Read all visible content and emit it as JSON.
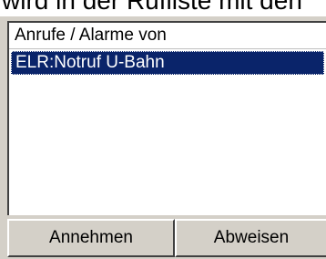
{
  "caption": "wird in der Rufliste mit den",
  "list": {
    "header": "Anrufe / Alarme von",
    "items": [
      {
        "label": "ELR:Notruf U-Bahn",
        "selected": true
      }
    ]
  },
  "buttons": {
    "accept_label": "Annehmen",
    "reject_label": "Abweisen"
  },
  "colors": {
    "selection": "#0a246a",
    "panel": "#d4d0c8"
  }
}
